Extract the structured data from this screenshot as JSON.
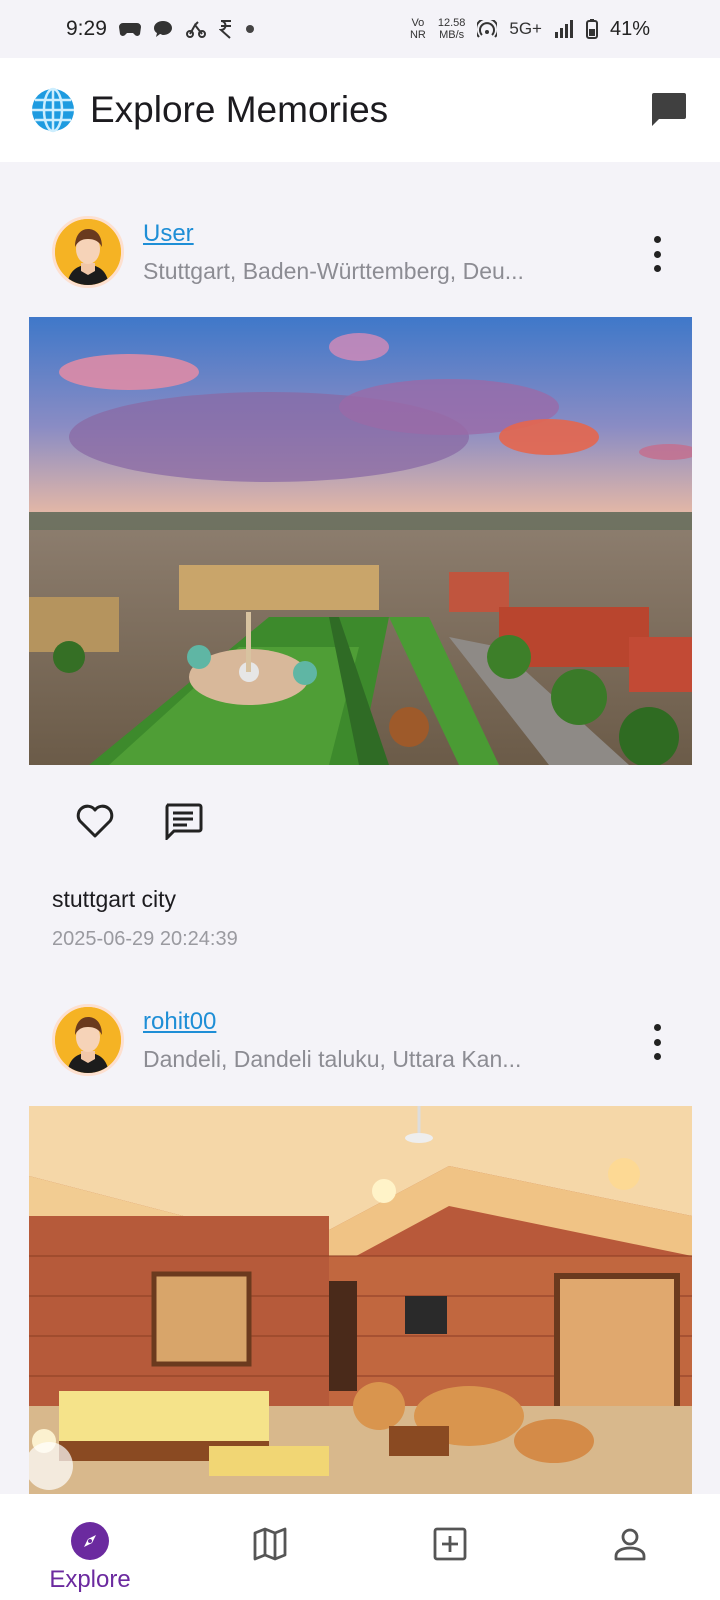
{
  "status": {
    "time": "9:29",
    "net_speed_top": "12.58",
    "net_speed_bottom": "MB/s",
    "volte_top": "Vo",
    "volte_bottom": "NR",
    "network": "5G+",
    "battery": "41%"
  },
  "header": {
    "title": "Explore Memories",
    "icons": [
      "globe-icon",
      "chat-icon"
    ]
  },
  "posts": [
    {
      "username": "User",
      "location": "Stuttgart, Baden-Württemberg, Deu...",
      "caption": "stuttgart city",
      "timestamp": "2025-06-29 20:24:39",
      "photo": "aerial-city-palace-square"
    },
    {
      "username": "rohit00",
      "location": "Dandeli, Dandeli taluku, Uttara Kan...",
      "photo": "stone-cottage-interior"
    }
  ],
  "bottom_nav": {
    "items": [
      {
        "label": "Explore",
        "icon": "compass-icon",
        "active": true
      },
      {
        "icon": "map-icon"
      },
      {
        "icon": "add-box-icon"
      },
      {
        "icon": "person-icon"
      }
    ]
  },
  "colors": {
    "accent": "#6b2a9f",
    "link": "#1e8ed6",
    "background": "#f4f3f8"
  }
}
